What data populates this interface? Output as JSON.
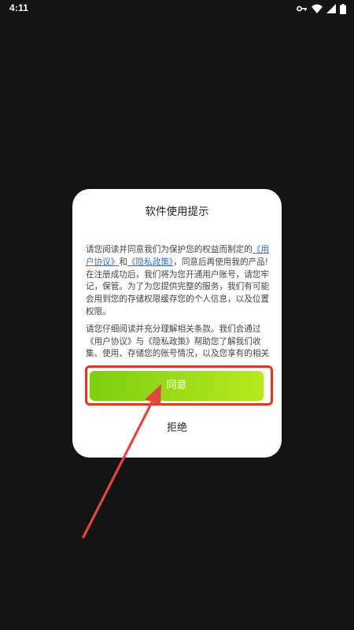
{
  "status_bar": {
    "time": "4:11",
    "icons": [
      "key-icon",
      "wifi-icon",
      "signal-icon",
      "battery-icon"
    ],
    "color": "#ffffff"
  },
  "dialog": {
    "title": "软件使用提示",
    "paragraph1": {
      "before": "请您阅读并同意我们为保护您的权益而制定的",
      "link_user_agreement": "《用户协议》",
      "and": "和",
      "link_privacy_policy": "《隐私政策》",
      "after": "，同意后再使用我的产品!在注册成功后，我们将为您开通用户账号，请您牢记，保管。为了为您提供完整的服务，我们有可能会用到您的存储权限缓存您的个人信息，以及位置权限。"
    },
    "paragraph2": "请您仔细阅读并充分理解相关条款。我们会通过《用户协议》与《隐私政策》帮助您了解我们收集、使用、存储您的账号情况，以及您享有的相关权利。",
    "agree_label": "同意",
    "refuse_label": "拒绝",
    "link_color": "#2c6fd6",
    "agree_gradient": [
      "#7ccf10",
      "#b7e91d"
    ]
  },
  "annotation": {
    "highlight_color": "#d9392a",
    "arrow_color": "#e0483a"
  }
}
